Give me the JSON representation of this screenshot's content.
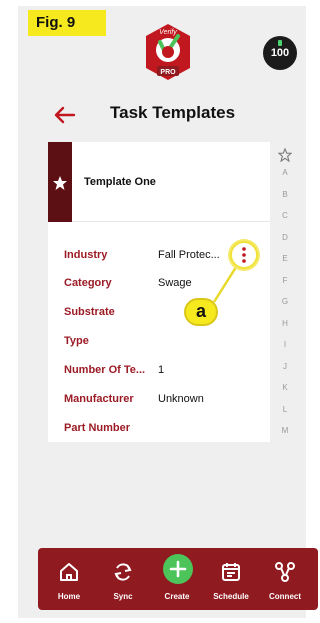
{
  "figure_label": "Fig. 9",
  "app": {
    "logo_text": "Verify",
    "logo_badge": "PRO",
    "score": "100"
  },
  "header": {
    "title": "Task Templates"
  },
  "template": {
    "name": "Template One",
    "fields": [
      {
        "label": "Industry",
        "value": "Fall Protec..."
      },
      {
        "label": "Category",
        "value": "Swage"
      },
      {
        "label": "Substrate",
        "value": ""
      },
      {
        "label": "Type",
        "value": ""
      },
      {
        "label": "Number Of Te...",
        "value": "1"
      },
      {
        "label": "Manufacturer",
        "value": "Unknown"
      },
      {
        "label": "Part Number",
        "value": ""
      }
    ]
  },
  "more_button_icon": "vertical-dots-icon",
  "callout": {
    "label": "a"
  },
  "alpha_index": [
    "A",
    "B",
    "C",
    "D",
    "E",
    "F",
    "G",
    "H",
    "I",
    "J",
    "K",
    "L",
    "M"
  ],
  "tabs": [
    {
      "label": "Home",
      "icon": "home-icon"
    },
    {
      "label": "Sync",
      "icon": "sync-icon"
    },
    {
      "label": "Create",
      "icon": "plus-icon"
    },
    {
      "label": "Schedule",
      "icon": "calendar-icon"
    },
    {
      "label": "Connect",
      "icon": "share-icon"
    }
  ],
  "colors": {
    "brand": "#8f1a20",
    "label_red": "#9b1b25",
    "create_green": "#4cc45a",
    "highlight_yellow": "#f6ea1f"
  }
}
